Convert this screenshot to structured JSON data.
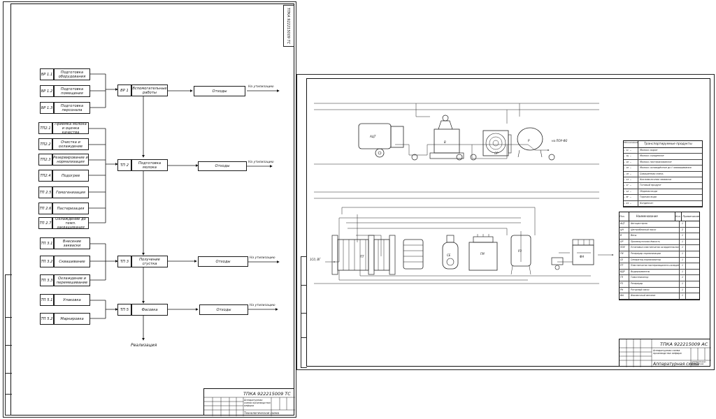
{
  "sheet1": {
    "stamp_code": "ТПКА 922215009 ТС",
    "stamp_title": "Технологическая схема",
    "prep": [
      {
        "code": "ВР 1.1",
        "label": "Подготовка оборудования"
      },
      {
        "code": "ВР 1.2",
        "label": "Подготовка помещения"
      },
      {
        "code": "ВР 1.3",
        "label": "Подготовка персонала"
      }
    ],
    "milk": [
      {
        "code": "ТП2.1",
        "label": "Приёмка молока и оценка качества"
      },
      {
        "code": "ТП2.2",
        "label": "Очистка и охлаждение"
      },
      {
        "code": "ТП2.3",
        "label": "Резервирование и нормализация"
      },
      {
        "code": "ТП2.4",
        "label": "Подогрев"
      },
      {
        "code": "ТП 2.5",
        "label": "Гомогенизация"
      },
      {
        "code": "ТП 2.6",
        "label": "Пастеризация"
      },
      {
        "code": "ТП 2.7",
        "label": "Охлаждение до темп. заквашивания"
      }
    ],
    "clot": [
      {
        "code": "ТП 3.1",
        "label": "Внесение закваски"
      },
      {
        "code": "ТП 3.2",
        "label": "Сквашивание"
      },
      {
        "code": "ТП 3.3",
        "label": "Охлаждение и перемешивание"
      }
    ],
    "pack": [
      {
        "code": "ТП 5.1",
        "label": "Упаковка"
      },
      {
        "code": "ТП 5.2",
        "label": "Маркировка"
      }
    ],
    "main": [
      {
        "code": "ВР 1",
        "label": "Вспомогательные работы"
      },
      {
        "code": "ТП 2",
        "label": "Подготовка молока"
      },
      {
        "code": "ТП 3",
        "label": "Получение сгустка"
      },
      {
        "code": "ТП 5",
        "label": "Фасовка"
      }
    ],
    "waste_label": "Отходы",
    "disposal_label": "На утилизацию",
    "realization_label": "Реализация"
  },
  "sheet2": {
    "stamp_code": "ТПКА 922215009 АС",
    "stamp_title": "Аппаратурная схема",
    "legend_title": "Транспортируемые продукты",
    "legend_col": "Обозначение",
    "legend": [
      {
        "code": "— 1С —",
        "label": "Молоко сырое"
      },
      {
        "code": "— 1Ц —",
        "label": "Молоко очищенное"
      },
      {
        "code": "— 1П —",
        "label": "Молоко пастеризованное"
      },
      {
        "code": "— 1Н —",
        "label": "Молоко охлаждённое до t заквашивания"
      },
      {
        "code": "— СП —",
        "label": "Сквашенная смесь"
      },
      {
        "code": "— 1З —",
        "label": "Кисломолочная закваска"
      },
      {
        "code": "— 1Г —",
        "label": "Готовый продукт"
      },
      {
        "code": "— 1Л —",
        "label": "Ледяная вода"
      },
      {
        "code": "— ВГ —",
        "label": "Горячая вода"
      },
      {
        "code": "— КЗ —",
        "label": "Конденсат"
      }
    ],
    "equip_header": [
      "Поз.",
      "Наименование",
      "Кол.",
      "Примечание"
    ],
    "equipment": [
      {
        "pos": "АЦТ",
        "name": "Автоцистерна",
        "qty": "1"
      },
      {
        "pos": "ЦН",
        "name": "Центробежный насос",
        "qty": "2"
      },
      {
        "pos": "В",
        "name": "Весы",
        "qty": "1"
      },
      {
        "pos": "ОР",
        "name": "Промежуточная ёмкость",
        "qty": "1"
      },
      {
        "pos": "ПОУ",
        "name": "Установка пластинчатая охладительная",
        "qty": "1"
      },
      {
        "pos": "ГМ",
        "name": "Резервуар нормализации",
        "qty": "1"
      },
      {
        "pos": "СЕ",
        "name": "Сепаратор-нормализатор",
        "qty": "1"
      },
      {
        "pos": "ПТ",
        "name": "Пластинчатая пастеризационно-охладительная установка",
        "qty": "1"
      },
      {
        "pos": "ВДР",
        "name": "Выдерживатель",
        "qty": "1"
      },
      {
        "pos": "ГП",
        "name": "Гомогенизатор",
        "qty": "1"
      },
      {
        "pos": "РЗ",
        "name": "Резервуар",
        "qty": "1"
      },
      {
        "pos": "РН",
        "name": "Роторный насос",
        "qty": "1"
      },
      {
        "pos": "ФА",
        "name": "Фасовочный автомат",
        "qty": "1"
      }
    ],
    "labels": {
      "atc": "АЦТ",
      "b": "В",
      "or": "ОР",
      "r": "Р",
      "sep": "СЕ",
      "gm": "ГМ",
      "pt": "ПТ",
      "rz": "РЗ",
      "fa": "ФА",
      "to_out": "на ПОУ-Ф2",
      "inlet": "1С0, ВГ"
    }
  },
  "stamp_common": {
    "doc_desc": "Аппаратурная схема производства кефира",
    "doc_desc2": "(аппаратурно-процессная схема)"
  }
}
